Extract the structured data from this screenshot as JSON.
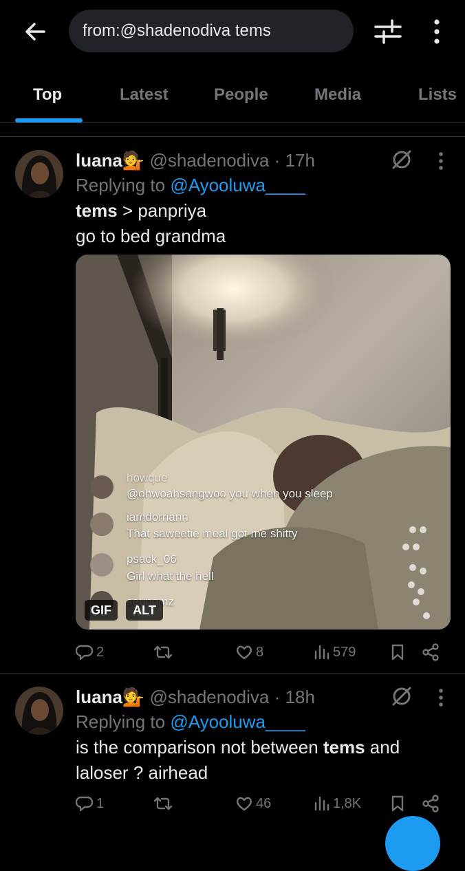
{
  "search": {
    "query": "from:@shadenodiva tems"
  },
  "tabs": [
    "Top",
    "Latest",
    "People",
    "Media",
    "Lists"
  ],
  "posts": [
    {
      "name": "luana",
      "handle": "@shadenodiva",
      "sep": "·",
      "time": "17h",
      "reply_prefix": "Replying to",
      "reply_to": "@Ayooluwa____",
      "text_bold": "tems",
      "text_rest": " > panpriya",
      "text_line2": "go to bed grandma",
      "media": {
        "overlay_comments": [
          {
            "user": "howque",
            "text": "@ohwoahsangwoo you when you sleep"
          },
          {
            "user": "iamdorriann",
            "text": "That saweetie meal got me shitty"
          },
          {
            "user": "psack_06",
            "text": "Girl what the hell"
          },
          {
            "user": "seungmz",
            "text": ""
          }
        ],
        "gif_label": "GIF",
        "alt_label": "ALT"
      },
      "stats": {
        "replies": "2",
        "reposts": "",
        "likes": "8",
        "views": "579"
      }
    },
    {
      "name": "luana",
      "handle": "@shadenodiva",
      "sep": "·",
      "time": "18h",
      "reply_prefix": "Replying to",
      "reply_to": "@Ayooluwa____",
      "text_a": "is the comparison not between ",
      "text_bold": "tems",
      "text_b": " and",
      "text_line2": "laloser ? airhead",
      "stats": {
        "replies": "1",
        "reposts": "",
        "likes": "46",
        "views": "1,8K"
      }
    }
  ],
  "icons": [
    "back-arrow-icon",
    "filter-sliders-icon",
    "more-vertical-icon",
    "grok-icon",
    "more-dots-icon",
    "reply-icon",
    "repost-icon",
    "like-icon",
    "views-icon",
    "bookmark-icon",
    "share-icon"
  ],
  "colors": {
    "background": "#000000",
    "accent": "#1d9bf0",
    "muted": "#71767b",
    "text": "#e7e9ea"
  }
}
